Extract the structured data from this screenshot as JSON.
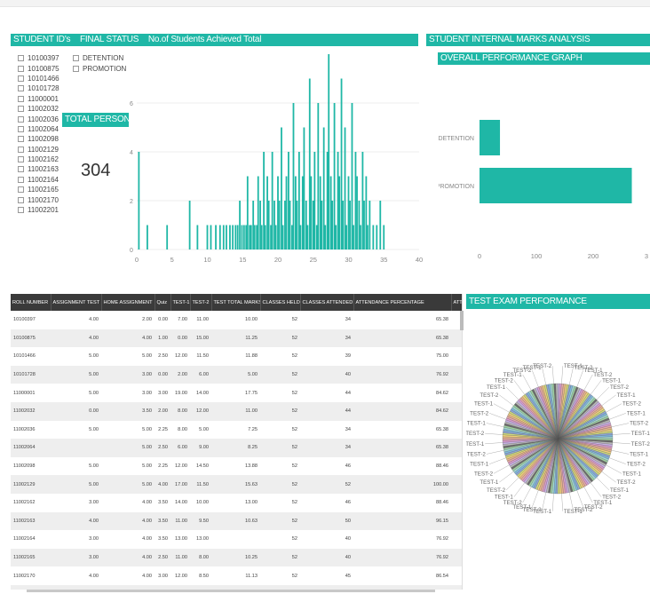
{
  "headers": {
    "student_ids": "STUDENT ID's",
    "final_status": "FINAL STATUS",
    "achieved_total": "No.of Students Achieved Total",
    "internal_marks": "STUDENT INTERNAL MARKS ANALYSIS",
    "overall_graph": "OVERALL PERFORMANCE GRAPH",
    "total_persons": "TOTAL PERSONS",
    "test_exam": "TEST EXAM PERFORMANCE"
  },
  "student_ids": [
    "10100397",
    "10100875",
    "10101466",
    "10101728",
    "11000001",
    "11002032",
    "11002036",
    "11002064",
    "11002098",
    "11002129",
    "11002162",
    "11002163",
    "11002164",
    "11002165",
    "11002170",
    "11002201"
  ],
  "final_status_options": [
    "DETENTION",
    "PROMOTION"
  ],
  "total_persons": "304",
  "table": {
    "columns": [
      "ROLL NUMBER",
      "ASSIGNMENT TEST",
      "HOME ASSIGNMENT",
      "Quiz",
      "TEST-1",
      "TEST-2",
      "TEST TOTAL MARKS",
      "CLASSES HELD",
      "CLASSES ATTENDED",
      "ATTENDANCE PERCENTAGE",
      "ATTEN"
    ],
    "rows": [
      [
        "10100397",
        "4.00",
        "2.00",
        "0.00",
        "7.00",
        "11.00",
        "10.00",
        "52",
        "34",
        "65.38"
      ],
      [
        "10100875",
        "4.00",
        "4.00",
        "1.00",
        "0.00",
        "15.00",
        "11.25",
        "52",
        "34",
        "65.38"
      ],
      [
        "10101466",
        "5.00",
        "5.00",
        "2.50",
        "12.00",
        "11.50",
        "11.88",
        "52",
        "39",
        "75.00"
      ],
      [
        "10101728",
        "5.00",
        "3.00",
        "0.00",
        "2.00",
        "6.00",
        "5.00",
        "52",
        "40",
        "76.92"
      ],
      [
        "11000001",
        "5.00",
        "3.00",
        "3.00",
        "19.00",
        "14.00",
        "17.75",
        "52",
        "44",
        "84.62"
      ],
      [
        "11002032",
        "0.00",
        "3.50",
        "2.00",
        "8.00",
        "12.00",
        "11.00",
        "52",
        "44",
        "84.62"
      ],
      [
        "11002036",
        "5.00",
        "5.00",
        "2.25",
        "8.00",
        "5.00",
        "7.25",
        "52",
        "34",
        "65.38"
      ],
      [
        "11002064",
        "",
        "5.00",
        "2.50",
        "6.00",
        "9.00",
        "8.25",
        "52",
        "34",
        "65.38"
      ],
      [
        "11002098",
        "5.00",
        "5.00",
        "2.25",
        "12.00",
        "14.50",
        "13.88",
        "52",
        "46",
        "88.46"
      ],
      [
        "11002129",
        "5.00",
        "5.00",
        "4.00",
        "17.00",
        "11.50",
        "15.63",
        "52",
        "52",
        "100.00"
      ],
      [
        "11002162",
        "3.00",
        "4.00",
        "3.50",
        "14.00",
        "10.00",
        "13.00",
        "52",
        "46",
        "88.46"
      ],
      [
        "11002163",
        "4.00",
        "4.00",
        "3.50",
        "11.00",
        "9.50",
        "10.63",
        "52",
        "50",
        "96.15"
      ],
      [
        "11002164",
        "3.00",
        "4.00",
        "3.50",
        "13.00",
        "13.00",
        "",
        "52",
        "40",
        "76.92"
      ],
      [
        "11002165",
        "3.00",
        "4.00",
        "2.50",
        "11.00",
        "8.00",
        "10.25",
        "52",
        "40",
        "76.92"
      ],
      [
        "11002170",
        "4.00",
        "4.00",
        "3.00",
        "12.00",
        "8.50",
        "11.13",
        "52",
        "45",
        "86.54"
      ],
      [
        "11002201",
        "5.00",
        "5.00",
        "2.50",
        "11.00",
        "14.00",
        "12.75",
        "52",
        "45",
        "86.54"
      ]
    ]
  },
  "pie_labels_left": [
    "TEST-2",
    "TEST-1",
    "TEST-2",
    "TEST-1",
    "TEST-2",
    "TEST-1",
    "TEST-2",
    "TEST-1",
    "TEST-2",
    "TEST-1",
    "TEST-2",
    "TEST-1",
    "TEST-2",
    "TEST-1",
    "TEST-2",
    "TEST-1",
    "TEST-2",
    "TEST-1",
    "TEST-2",
    "TEST-1",
    "TEST-2",
    "TEST-1"
  ],
  "pie_labels_right": [
    "TEST-1",
    "TEST-2",
    "TEST-1",
    "TEST-2",
    "TEST-1",
    "TEST-2",
    "TEST-1",
    "TEST-2",
    "TEST-1",
    "TEST-2",
    "TEST-1",
    "TEST-2",
    "TEST-1",
    "TEST-2",
    "TEST-1",
    "TEST-2",
    "TEST-1",
    "TEST-2",
    "TEST-1",
    "TEST-2",
    "TEST-2",
    "TEST-1"
  ],
  "colors": {
    "accent": "#1fb7a6",
    "table_header": "#3a3a3a"
  },
  "chart_data": [
    {
      "type": "bar",
      "title": "No.of Students Achieved Total",
      "x_ticks": [
        "0",
        "5",
        "10",
        "15",
        "20",
        "25",
        "30",
        "35",
        "40"
      ],
      "y_ticks": [
        "0",
        "2",
        "4",
        "6"
      ],
      "xlim": [
        0,
        40
      ],
      "ylim": [
        0,
        8
      ],
      "x": [
        0.3,
        1.5,
        4.3,
        7.5,
        8.6,
        10,
        10.5,
        11.2,
        11.8,
        12.3,
        12.7,
        13.2,
        13.6,
        14,
        14.3,
        14.6,
        14.9,
        15.2,
        15.5,
        15.7,
        16,
        16.2,
        16.5,
        16.7,
        17,
        17.2,
        17.5,
        17.7,
        18,
        18.2,
        18.5,
        18.7,
        19,
        19.2,
        19.5,
        19.7,
        20,
        20.2,
        20.5,
        20.7,
        21,
        21.2,
        21.5,
        21.7,
        22,
        22.2,
        22.5,
        22.7,
        23,
        23.2,
        23.5,
        23.7,
        24,
        24.2,
        24.5,
        24.7,
        25,
        25.2,
        25.5,
        25.7,
        26,
        26.2,
        26.5,
        26.7,
        27,
        27.2,
        27.5,
        27.7,
        28,
        28.2,
        28.5,
        28.7,
        29,
        29.2,
        29.5,
        29.7,
        30,
        30.2,
        30.5,
        30.7,
        31,
        31.2,
        31.5,
        31.7,
        32,
        32.2,
        32.5,
        32.7,
        33,
        33.5,
        34,
        34.5,
        35
      ],
      "values": [
        4,
        1,
        1,
        2,
        1,
        1,
        1,
        1,
        1,
        1,
        1,
        1,
        1,
        1,
        1,
        2,
        1,
        1,
        1,
        3,
        1,
        1,
        2,
        1,
        1,
        3,
        2,
        1,
        4,
        1,
        3,
        2,
        1,
        4,
        2,
        1,
        3,
        2,
        5,
        1,
        2,
        3,
        4,
        2,
        1,
        6,
        3,
        2,
        4,
        1,
        3,
        5,
        2,
        1,
        7,
        3,
        2,
        4,
        1,
        6,
        3,
        2,
        5,
        1,
        4,
        8,
        3,
        2,
        6,
        1,
        4,
        3,
        7,
        2,
        5,
        1,
        3,
        2,
        6,
        1,
        4,
        3,
        2,
        1,
        4,
        2,
        3,
        1,
        2,
        1,
        1,
        2,
        1
      ]
    },
    {
      "type": "bar",
      "title": "OVERALL PERFORMANCE GRAPH",
      "orientation": "horizontal",
      "categories": [
        "DETENTION",
        "PROMOTION"
      ],
      "values": [
        36,
        268
      ],
      "x_ticks": [
        "0",
        "100",
        "200",
        "3"
      ],
      "xlim": [
        0,
        300
      ]
    },
    {
      "type": "pie",
      "title": "TEST EXAM PERFORMANCE",
      "slice_count": 180,
      "categories": [
        "TEST-1",
        "TEST-2"
      ]
    }
  ]
}
